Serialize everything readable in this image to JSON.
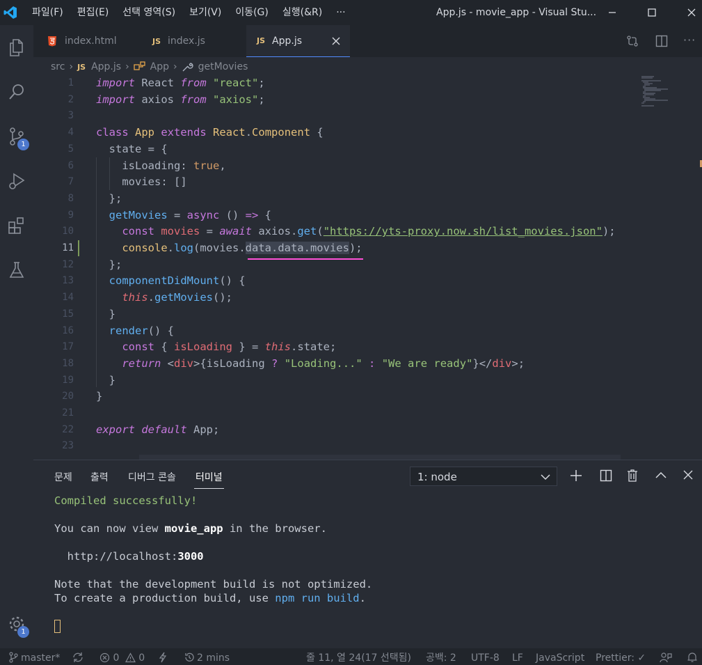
{
  "menu": [
    "파일(F)",
    "편집(E)",
    "선택 영역(S)",
    "보기(V)",
    "이동(G)",
    "실행(&R)",
    "···"
  ],
  "window_title": "App.js - movie_app - Visual Stu...",
  "activity_badges": {
    "source_control": "1",
    "settings": "1"
  },
  "tabs": [
    {
      "label": "index.html",
      "icon": "html5-icon",
      "active": false
    },
    {
      "label": "index.js",
      "icon": "js-icon",
      "active": false
    },
    {
      "label": "App.js",
      "icon": "js-icon",
      "active": true
    }
  ],
  "js_badge_text": "JS",
  "breadcrumb": {
    "folder": "src",
    "file": "App.js",
    "class": "App",
    "method": "getMovies"
  },
  "line_numbers": [
    "1",
    "2",
    "3",
    "4",
    "5",
    "6",
    "7",
    "8",
    "9",
    "10",
    "11",
    "12",
    "13",
    "14",
    "15",
    "16",
    "17",
    "18",
    "19",
    "20",
    "21",
    "22",
    "23"
  ],
  "panel": {
    "tabs": [
      "문제",
      "출력",
      "디버그 콘솔",
      "터미널"
    ],
    "active_tab": "터미널",
    "terminal_select": "1: node",
    "terminal": {
      "compiled": "Compiled successfully!",
      "view_prefix": "You can now view ",
      "app_name": "movie_app",
      "view_suffix": " in the browser.",
      "url_prefix": "  http://localhost:",
      "port": "3000",
      "note": "Note that the development build is not optimized.",
      "create_prefix": "To create a production build, use ",
      "npm_cmd": "npm run build",
      "create_suffix": "."
    }
  },
  "status": {
    "branch": "master*",
    "errors": "0",
    "warnings": "0",
    "time": "2 mins",
    "position": "줄 11, 열 24(17 선택됨)",
    "spaces": "공백: 2",
    "encoding": "UTF-8",
    "eol": "LF",
    "language": "JavaScript",
    "prettier": "Prettier: ✓"
  },
  "colors": {
    "accent": "#4d78cc",
    "background": "#282c34",
    "titlebar": "#21252b",
    "underline": "#ff50d8"
  }
}
